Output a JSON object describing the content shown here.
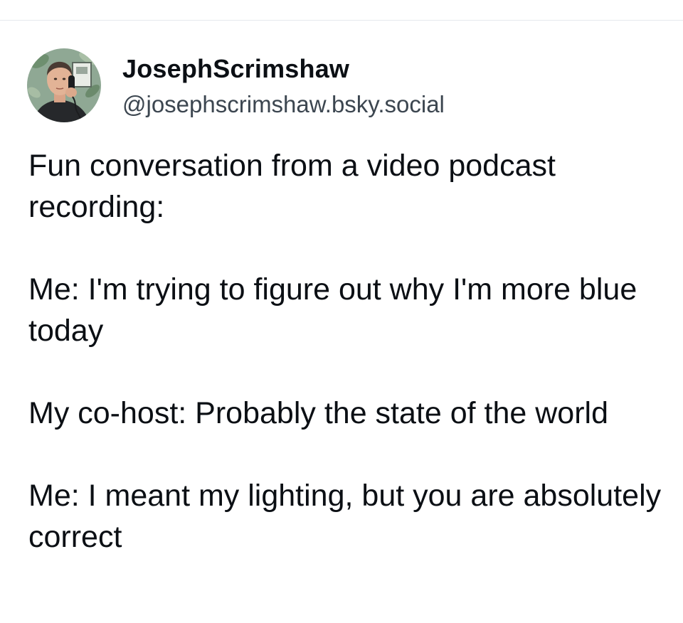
{
  "post": {
    "author": {
      "display_name": "JosephScrimshaw",
      "handle": "@josephscrimshaw.bsky.social",
      "avatar": "profile-photo"
    },
    "body": [
      "Fun conversation from a video podcast recording:",
      "Me: I'm trying to figure out why I'm more blue today",
      "My co-host: Probably the state of the world",
      "Me: I meant my lighting, but you are absolutely correct"
    ]
  }
}
